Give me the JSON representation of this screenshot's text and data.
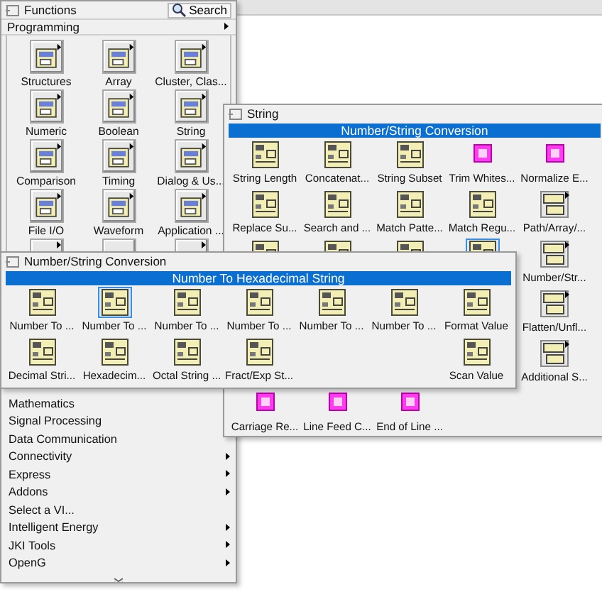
{
  "functions_palette": {
    "title": "Functions",
    "search_button": "Search",
    "category": "Programming",
    "grid": [
      {
        "label": "Structures",
        "submenu": true
      },
      {
        "label": "Array",
        "submenu": true
      },
      {
        "label": "Cluster, Clas...",
        "submenu": true
      },
      {
        "label": "Numeric",
        "submenu": true
      },
      {
        "label": "Boolean",
        "submenu": true
      },
      {
        "label": "String",
        "submenu": true
      },
      {
        "label": "Comparison",
        "submenu": true
      },
      {
        "label": "Timing",
        "submenu": true
      },
      {
        "label": "Dialog & Us...",
        "submenu": true
      },
      {
        "label": "File I/O",
        "submenu": true
      },
      {
        "label": "Waveform",
        "submenu": true
      },
      {
        "label": "Application ...",
        "submenu": true
      },
      {
        "submenu": true
      },
      {
        "submenu": false
      },
      {
        "submenu": true
      }
    ],
    "categories": [
      {
        "label": "Mathematics"
      },
      {
        "label": "Signal Processing"
      },
      {
        "label": "Data Communication",
        "submenu": false
      },
      {
        "label": "Connectivity",
        "submenu": true
      },
      {
        "label": "Express",
        "submenu": true
      },
      {
        "label": "Addons",
        "submenu": true
      },
      {
        "label": "Select a VI...",
        "submenu": false
      },
      {
        "label": "Intelligent Energy",
        "submenu": true
      },
      {
        "label": "JKI Tools",
        "submenu": true
      },
      {
        "label": "OpenG",
        "submenu": true
      }
    ]
  },
  "string_palette": {
    "title": "String",
    "highlight": "Number/String Conversion",
    "rows": [
      [
        {
          "kind": "function",
          "label": "String Length",
          "selected": false
        },
        {
          "kind": "function",
          "label": "Concatenat...",
          "selected": false
        },
        {
          "kind": "function",
          "label": "String Subset",
          "selected": false
        },
        {
          "kind": "constant",
          "label": "Trim Whites...",
          "selected": false
        },
        {
          "kind": "constant",
          "label": "Normalize E...",
          "selected": false
        }
      ],
      [
        {
          "kind": "function",
          "label": "Replace Su...",
          "selected": false
        },
        {
          "kind": "function",
          "label": "Search and ...",
          "selected": false
        },
        {
          "kind": "function",
          "label": "Match Patte...",
          "selected": false
        },
        {
          "kind": "function",
          "label": "Match Regu...",
          "selected": false
        },
        {
          "kind": "subpalette",
          "label": "Path/Array/...",
          "selected": false
        }
      ],
      [
        {
          "kind": "function",
          "selected": false
        },
        {
          "kind": "function",
          "selected": false
        },
        {
          "kind": "function",
          "selected": false
        },
        {
          "kind": "function",
          "selected": true
        },
        {
          "kind": "subpalette",
          "label": "Number/Str...",
          "selected": false
        }
      ],
      [
        {
          "kind": "covered"
        },
        {
          "kind": "covered"
        },
        {
          "kind": "covered"
        },
        {
          "kind": "covered"
        },
        {
          "kind": "subpalette",
          "label": "Flatten/Unfl...",
          "selected": false
        }
      ],
      [
        {
          "kind": "covered"
        },
        {
          "kind": "covered"
        },
        {
          "kind": "covered"
        },
        {
          "kind": "covered"
        },
        {
          "kind": "subpalette",
          "label": "Additional S...",
          "selected": false
        }
      ],
      [
        {
          "kind": "constant",
          "label": "Carriage Re...",
          "selected": false
        },
        {
          "kind": "constant",
          "label": "Line Feed C...",
          "selected": false
        },
        {
          "kind": "constant",
          "label": "End of Line ...",
          "selected": false
        }
      ]
    ]
  },
  "conversion_palette": {
    "title": "Number/String Conversion",
    "highlight": "Number To Hexadecimal String",
    "rows": [
      [
        {
          "kind": "function",
          "label": "Number To ...",
          "selected": false
        },
        {
          "kind": "function",
          "label": "Number To ...",
          "selected": true
        },
        {
          "kind": "function",
          "label": "Number To ...",
          "selected": false
        },
        {
          "kind": "function",
          "label": "Number To ...",
          "selected": false
        },
        {
          "kind": "function",
          "label": "Number To ...",
          "selected": false
        },
        {
          "kind": "function",
          "label": "Number To ...",
          "selected": false
        },
        {
          "kind": "function",
          "label": "Format Value",
          "selected": false
        }
      ],
      [
        {
          "kind": "function",
          "label": "Decimal Stri...",
          "selected": false
        },
        {
          "kind": "function",
          "label": "Hexadecim...",
          "selected": false
        },
        {
          "kind": "function",
          "label": "Octal String ...",
          "selected": false
        },
        {
          "kind": "function",
          "label": "Fract/Exp St...",
          "selected": false
        },
        {
          "kind": "empty"
        },
        {
          "kind": "empty"
        },
        {
          "kind": "function",
          "label": "Scan Value",
          "selected": false
        }
      ]
    ]
  }
}
